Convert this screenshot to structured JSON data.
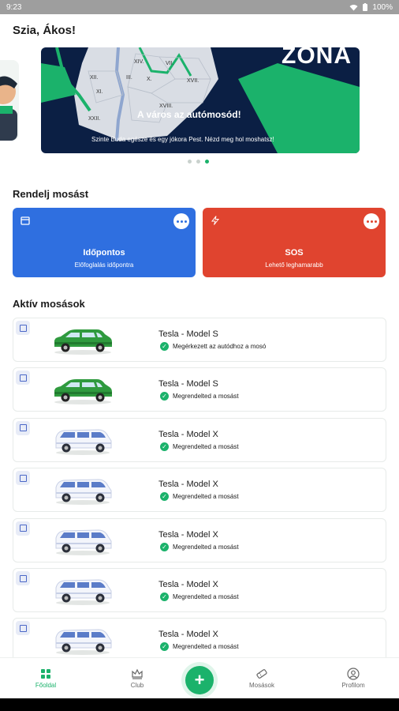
{
  "status": {
    "time": "9:23",
    "battery": "100%"
  },
  "greeting": "Szia, Ákos!",
  "banner": {
    "brand": "ZONA",
    "headline": "A város az autómosód!",
    "subtext": "Szinte Buda egésze és egy jókora Pest. Nézd meg hol moshatsz!",
    "districts": [
      "XIV.",
      "VII.",
      "XII.",
      "XVII.",
      "XI.",
      "III.",
      "X.",
      "XXII.",
      "XVIII."
    ],
    "page_count": 3,
    "active_page": 3
  },
  "order": {
    "title": "Rendelj mosást",
    "scheduled": {
      "title": "Időpontos",
      "subtitle": "Előfoglalás időpontra",
      "color": "#2f6fe0",
      "icon": "calendar-icon"
    },
    "sos": {
      "title": "SOS",
      "subtitle": "Lehető leghamarabb",
      "color": "#e0442f",
      "icon": "lightning-icon"
    }
  },
  "active": {
    "title": "Aktív mosások",
    "items": [
      {
        "name": "Tesla - Model S",
        "status": "Megérkezett az autódhoz a mosó",
        "car": "green-suv"
      },
      {
        "name": "Tesla - Model S",
        "status": "Megrendelted a mosást",
        "car": "green-suv"
      },
      {
        "name": "Tesla - Model X",
        "status": "Megrendelted a mosást",
        "car": "white-van"
      },
      {
        "name": "Tesla - Model X",
        "status": "Megrendelted a mosást",
        "car": "white-van"
      },
      {
        "name": "Tesla - Model X",
        "status": "Megrendelted a mosást",
        "car": "white-van"
      },
      {
        "name": "Tesla - Model X",
        "status": "Megrendelted a mosást",
        "car": "white-van"
      },
      {
        "name": "Tesla - Model X",
        "status": "Megrendelted a mosást",
        "car": "white-van"
      }
    ]
  },
  "nav": {
    "home": "Főoldal",
    "club": "Club",
    "washes": "Mosások",
    "profile": "Profilom",
    "fab": "+"
  },
  "colors": {
    "accent": "#1bb26b",
    "blue": "#2f6fe0",
    "red": "#e0442f"
  }
}
